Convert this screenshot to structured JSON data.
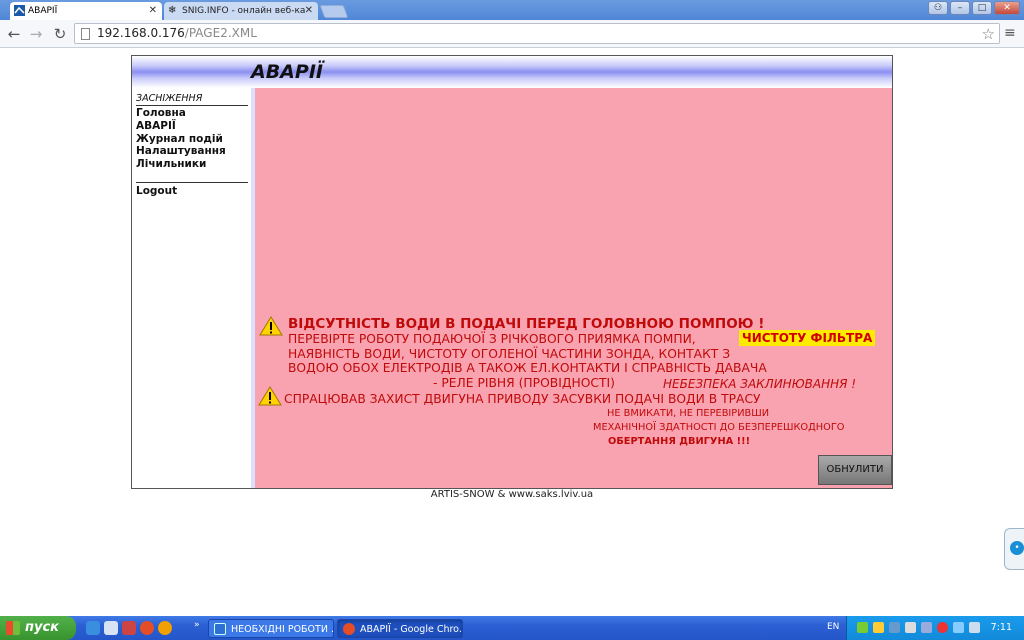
{
  "browser": {
    "tabs": [
      {
        "label": "АВАРІЇ",
        "active": true
      },
      {
        "label": "SNIG.INFO - онлайн веб-ка",
        "active": false
      }
    ],
    "url_host": "192.168.0.176",
    "url_path": "/PAGE2.XML",
    "window_buttons": {
      "user": "⚇",
      "minimize": "–",
      "maximize": "□",
      "close": "✕"
    }
  },
  "page": {
    "header_title": "АВАРІЇ",
    "sidebar": {
      "subheading": "ЗАСНІЖЕННЯ",
      "items": [
        "Головна",
        "АВАРІЇ",
        "Журнал подій",
        "Налаштування",
        "Лічильники"
      ],
      "logout": "Logout"
    },
    "alarm1": {
      "title": "ВІДСУТНІСТЬ ВОДИ В ПОДАЧІ ПЕРЕД ГОЛОВНОЮ ПОМПОЮ !",
      "line1": "ПЕРЕВІРТЕ РОБОТУ ПОДАЮЧОЇ З РІЧКОВОГО ПРИЯМКА ПОМПИ,",
      "highlight": "ЧИСТОТУ ФІЛЬТРА",
      "line2": "НАЯВНІСТЬ ВОДИ, ЧИСТОТУ ОГОЛЕНОЇ ЧАСТИНИ ЗОНДА, КОНТАКТ З",
      "line3": "ВОДОЮ ОБОХ ЕЛЕКТРОДІВ А ТАКОЖ ЕЛ.КОНТАКТИ І СПРАВНІСТЬ ДАВАЧА",
      "line4": "- РЕЛЕ РІВНЯ (ПРОВІДНОСТІ)",
      "danger": "НЕБЕЗПЕКА ЗАКЛИНЮВАННЯ !"
    },
    "alarm2": {
      "title": "СПРАЦЮВАВ ЗАХИСТ ДВИГУНА ПРИВОДУ ЗАСУВКИ ПОДАЧІ ВОДИ В ТРАСУ",
      "line1": "НЕ ВМИКАТИ, НЕ ПЕРЕВІРИВШИ",
      "line2": "МЕХАНІЧНОЇ ЗДАТНОСТІ ДО БЕЗПЕРЕШКОДНОГО",
      "line3": "ОБЕРТАННЯ ДВИГУНА !!!"
    },
    "reset_button": "ОБНУЛИТИ",
    "footer": "ARTIS-SNOW & www.saks.lviv.ua"
  },
  "taskbar": {
    "start_label": "пуск",
    "tasks": [
      "НЕОБХІДНІ РОБОТИ ...",
      "АВАРІЇ - Google Chro..."
    ],
    "language": "EN",
    "clock": "7:11"
  },
  "colors": {
    "alarm_background": "#f9a3b0",
    "alarm_text": "#c00a0a",
    "highlight": "#ffeb00",
    "header_band": "#8b8ff0"
  }
}
